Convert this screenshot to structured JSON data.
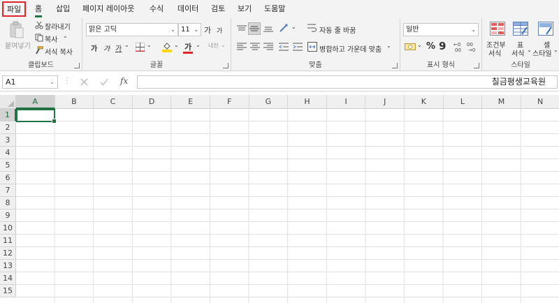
{
  "tabs": [
    "파일",
    "홈",
    "삽입",
    "페이지 레이아웃",
    "수식",
    "데이터",
    "검토",
    "보기",
    "도움말"
  ],
  "clipboard": {
    "paste": "붙여넣기",
    "cut": "잘라내기",
    "copy": "복사",
    "format_painter": "서식 복사",
    "label": "클립보드"
  },
  "font": {
    "name": "맑은 고딕",
    "size": "11",
    "grow": "가",
    "shrink": "가",
    "bold": "가",
    "italic": "가",
    "underline": "가",
    "font_color": "가",
    "phonetic": "내천",
    "label": "글꼴"
  },
  "alignment": {
    "wrap_text": "자동 줄 바꿈",
    "merge_center": "병합하고 가운데 맞춤",
    "label": "맞춤"
  },
  "number": {
    "format": "일반",
    "percent": "%",
    "comma": "9",
    "label": "표시 형식"
  },
  "styles": {
    "conditional_1": "조건부",
    "conditional_2": "서식",
    "table_1": "표",
    "table_2": "서식",
    "cell_1": "셀",
    "cell_2": "스타일",
    "label": "스타일"
  },
  "formula_bar": {
    "name_box": "A1",
    "fx": "fx",
    "content": "칠금평생교육원"
  },
  "sheet": {
    "columns": [
      "A",
      "B",
      "C",
      "D",
      "E",
      "F",
      "G",
      "H",
      "I",
      "J",
      "K",
      "L",
      "M",
      "N"
    ],
    "rows": [
      "1",
      "2",
      "3",
      "4",
      "5",
      "6",
      "7",
      "8",
      "9",
      "10",
      "11",
      "12",
      "13",
      "14",
      "15"
    ]
  },
  "colors": {
    "accent": "#217346",
    "highlight": "#e0262b",
    "font_color_bar": "#e0262b",
    "fill_color_bar": "#ffd800"
  }
}
